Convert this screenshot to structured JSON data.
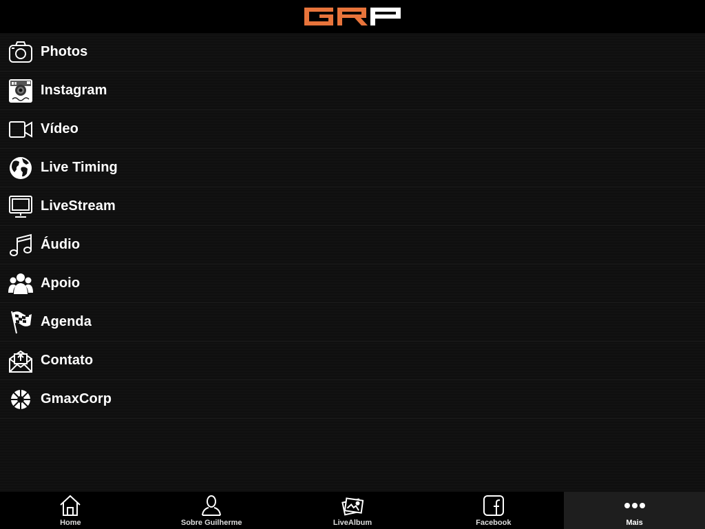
{
  "header": {
    "logo_text": "GRP",
    "logo_colors": {
      "primary": "#e8743b",
      "secondary": "#ffffff"
    }
  },
  "menu": {
    "items": [
      {
        "label": "Photos",
        "icon": "camera-icon"
      },
      {
        "label": "Instagram",
        "icon": "instagram-icon"
      },
      {
        "label": "Vídeo",
        "icon": "video-camera-icon"
      },
      {
        "label": "Live Timing",
        "icon": "globe-icon"
      },
      {
        "label": "LiveStream",
        "icon": "monitor-icon"
      },
      {
        "label": "Áudio",
        "icon": "music-note-icon"
      },
      {
        "label": "Apoio",
        "icon": "people-icon"
      },
      {
        "label": "Agenda",
        "icon": "checkered-flag-icon"
      },
      {
        "label": "Contato",
        "icon": "envelope-icon"
      },
      {
        "label": "GmaxCorp",
        "icon": "sun-wheel-icon"
      }
    ]
  },
  "tabbar": {
    "tabs": [
      {
        "label": "Home",
        "icon": "home-icon",
        "active": false
      },
      {
        "label": "Sobre Guilherme",
        "icon": "person-icon",
        "active": false
      },
      {
        "label": "LiveAlbum",
        "icon": "photo-album-icon",
        "active": false
      },
      {
        "label": "Facebook",
        "icon": "facebook-icon",
        "active": false
      },
      {
        "label": "Mais",
        "icon": "more-dots-icon",
        "active": true
      }
    ]
  }
}
